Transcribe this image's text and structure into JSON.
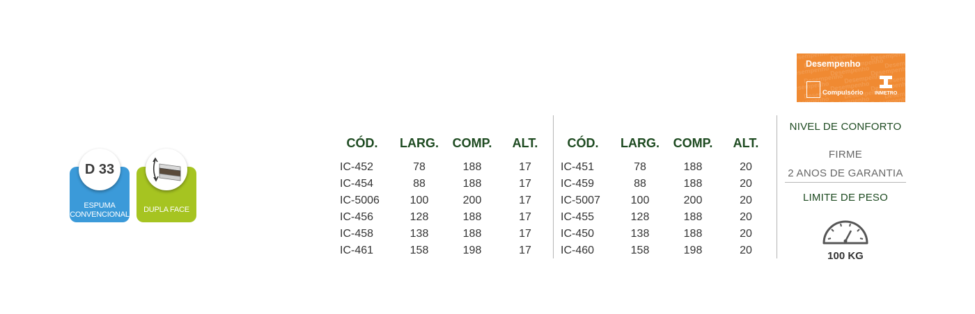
{
  "badges": {
    "density": {
      "label": "D 33",
      "caption_line1": "ESPUMA",
      "caption_line2": "CONVENCIONAL",
      "icon": "density-icon",
      "color": "#3b9ad9"
    },
    "double_face": {
      "caption": "DUPLA FACE",
      "icon": "mattress-flip-icon",
      "color": "#a6c421"
    }
  },
  "headers": [
    "CÓD.",
    "LARG.",
    "COMP.",
    "ALT."
  ],
  "table_left": [
    [
      "IC-452",
      "78",
      "188",
      "17"
    ],
    [
      "IC-454",
      "88",
      "188",
      "17"
    ],
    [
      "IC-5006",
      "100",
      "200",
      "17"
    ],
    [
      "IC-456",
      "128",
      "188",
      "17"
    ],
    [
      "IC-458",
      "138",
      "188",
      "17"
    ],
    [
      "IC-461",
      "158",
      "198",
      "17"
    ]
  ],
  "table_right": [
    [
      "IC-451",
      "78",
      "188",
      "20"
    ],
    [
      "IC-459",
      "88",
      "188",
      "20"
    ],
    [
      "IC-5007",
      "100",
      "200",
      "20"
    ],
    [
      "IC-455",
      "128",
      "188",
      "20"
    ],
    [
      "IC-450",
      "138",
      "188",
      "20"
    ],
    [
      "IC-460",
      "158",
      "198",
      "20"
    ]
  ],
  "inmetro": {
    "title": "Desempenho",
    "subtitle": "Compulsório",
    "brand": "INMETRO",
    "watermark": "Desempenho",
    "color": "#f08a32"
  },
  "comfort": {
    "title": "NIVEL DE CONFORTO",
    "level": "FIRME",
    "warranty": "2 ANOS DE GARANTIA"
  },
  "weight": {
    "title": "LIMITE DE PESO",
    "value": "100 KG",
    "icon": "gauge-icon"
  },
  "colors": {
    "heading_green": "#1d4a20",
    "divider": "#b5b5b5"
  }
}
